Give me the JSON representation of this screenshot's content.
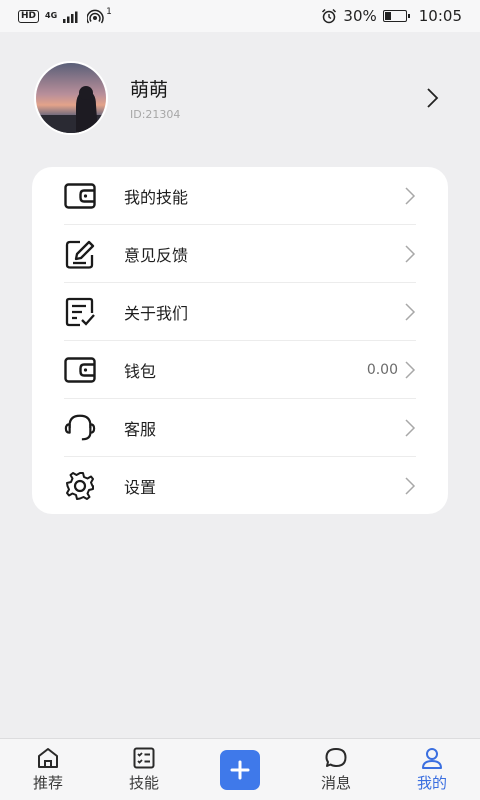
{
  "status_bar": {
    "hd": "HD",
    "net_top": "4G",
    "net_bottom": "⁴⁶",
    "hotspot_count": "1",
    "battery": "30%",
    "time": "10:05"
  },
  "profile": {
    "name": "萌萌",
    "id": "ID:21304"
  },
  "menu": {
    "items": [
      {
        "label": "我的技能",
        "icon": "wallet-icon",
        "value": ""
      },
      {
        "label": "意见反馈",
        "icon": "feedback-edit-icon",
        "value": ""
      },
      {
        "label": "关于我们",
        "icon": "document-check-icon",
        "value": ""
      },
      {
        "label": "钱包",
        "icon": "wallet-icon",
        "value": "0.00"
      },
      {
        "label": "客服",
        "icon": "headset-icon",
        "value": ""
      },
      {
        "label": "设置",
        "icon": "gear-icon",
        "value": ""
      }
    ]
  },
  "nav": {
    "items": [
      {
        "label": "推荐",
        "icon": "home-icon",
        "active": false
      },
      {
        "label": "技能",
        "icon": "list-icon",
        "active": false
      },
      {
        "label": "",
        "icon": "plus-icon",
        "active": false
      },
      {
        "label": "消息",
        "icon": "chat-icon",
        "active": false
      },
      {
        "label": "我的",
        "icon": "user-icon",
        "active": true
      }
    ]
  },
  "colors": {
    "accent": "#3f79ea",
    "active_text": "#3b6fe0",
    "background": "#eeeef0"
  }
}
